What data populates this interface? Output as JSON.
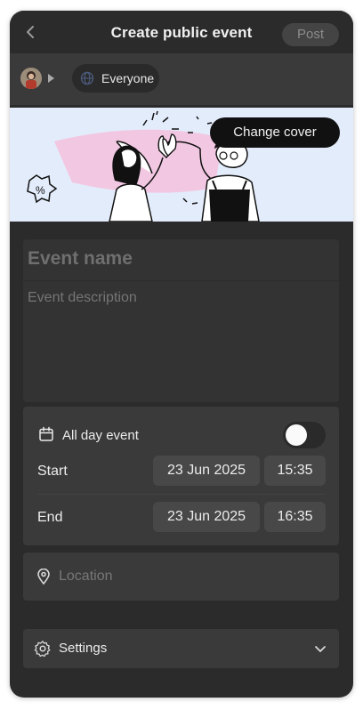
{
  "header": {
    "back_icon": "chevron-left-icon",
    "title": "Create public event",
    "post_label": "Post"
  },
  "audience": {
    "avatar_icon": "user-avatar",
    "label": "Everyone",
    "icon": "globe-icon"
  },
  "cover": {
    "change_label": "Change cover"
  },
  "event": {
    "name_placeholder": "Event name",
    "description_placeholder": "Event description"
  },
  "timing": {
    "all_day_label": "All day event",
    "all_day_on": false,
    "start_label": "Start",
    "start_date": "23 Jun 2025",
    "start_time": "15:35",
    "end_label": "End",
    "end_date": "23 Jun 2025",
    "end_time": "16:35"
  },
  "location": {
    "placeholder": "Location",
    "icon": "map-pin-icon"
  },
  "settings": {
    "label": "Settings",
    "icon": "gear-icon",
    "expand_icon": "chevron-down-icon"
  }
}
